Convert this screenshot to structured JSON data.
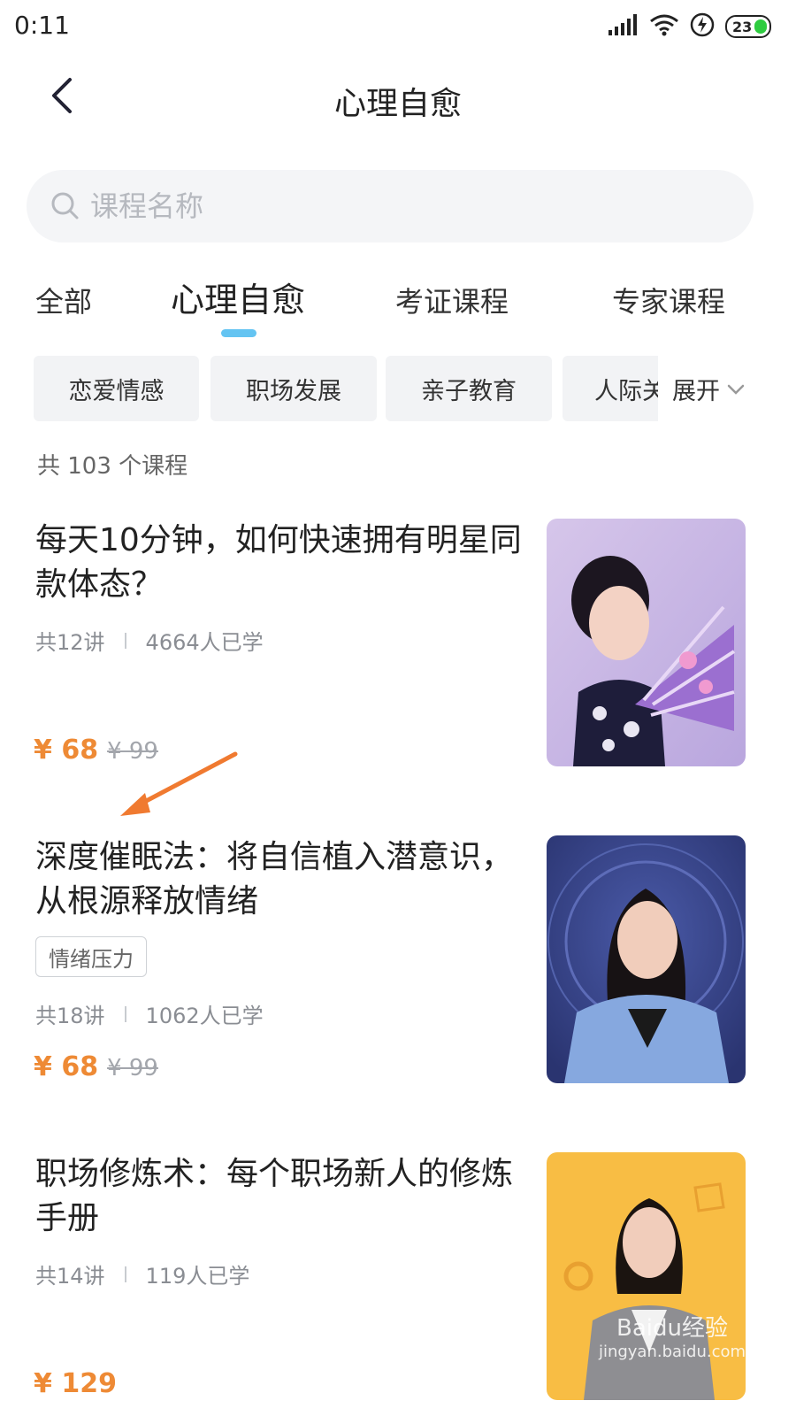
{
  "status_bar": {
    "time": "0:11",
    "battery": "23"
  },
  "header": {
    "title": "心理自愈"
  },
  "search": {
    "placeholder": "课程名称"
  },
  "tabs": [
    {
      "label": "全部"
    },
    {
      "label": "心理自愈",
      "active": true
    },
    {
      "label": "考证课程"
    },
    {
      "label": "专家课程"
    }
  ],
  "chips": [
    {
      "label": "恋爱情感"
    },
    {
      "label": "职场发展"
    },
    {
      "label": "亲子教育"
    },
    {
      "label": "人际关系"
    }
  ],
  "expand_label": "展开",
  "course_count": "共 103 个课程",
  "courses": [
    {
      "title": "每天10分钟，如何快速拥有明星同款体态？",
      "lessons": "共12讲",
      "learners": "4664人已学",
      "price": "¥ 68",
      "original_price": "¥ 99"
    },
    {
      "title": "深度催眠法：将自信植入潜意识，从根源释放情绪",
      "tag": "情绪压力",
      "lessons": "共18讲",
      "learners": "1062人已学",
      "price": "¥ 68",
      "original_price": "¥ 99"
    },
    {
      "title": "职场修炼术：每个职场新人的修炼手册",
      "lessons": "共14讲",
      "learners": "119人已学",
      "price": "¥ 129"
    }
  ],
  "watermark": {
    "brand": "Baidu经验",
    "url": "jingyan.baidu.com"
  },
  "colors": {
    "accent": "#64c4f2",
    "price": "#ee8a35",
    "annotation_arrow": "#f07a30"
  }
}
